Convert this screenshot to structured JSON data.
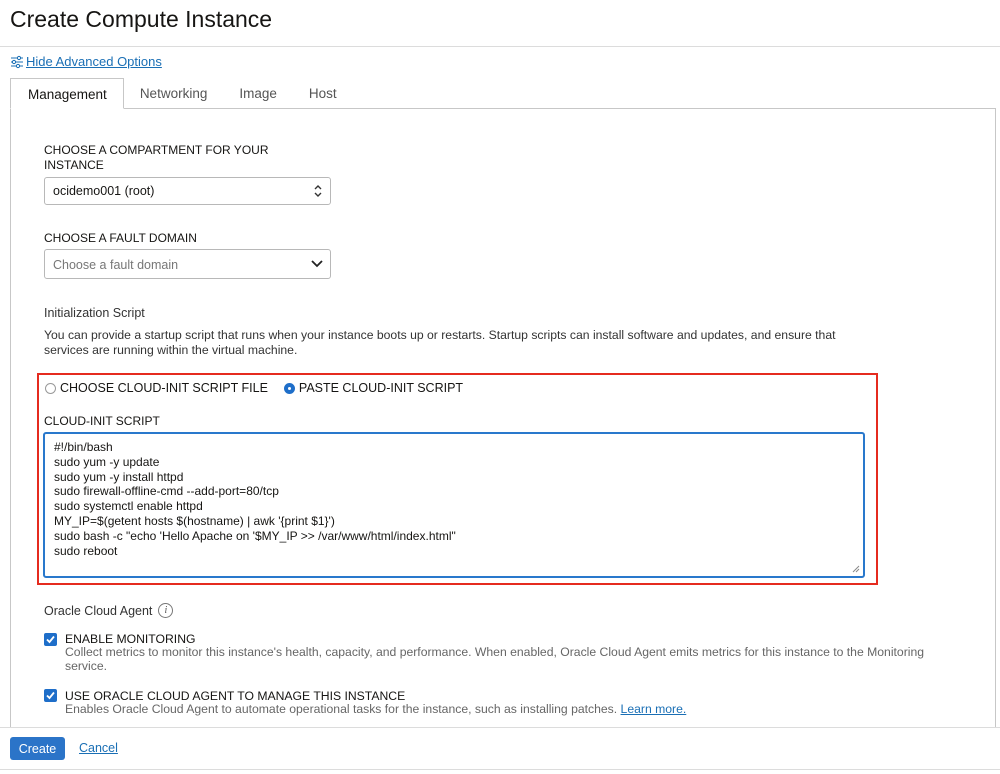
{
  "page": {
    "title": "Create Compute Instance"
  },
  "advanced": {
    "label": "Hide Advanced Options"
  },
  "tabs": [
    {
      "label": "Management",
      "active": true
    },
    {
      "label": "Networking",
      "active": false
    },
    {
      "label": "Image",
      "active": false
    },
    {
      "label": "Host",
      "active": false
    }
  ],
  "compartment": {
    "label_line1": "CHOOSE A COMPARTMENT FOR YOUR",
    "label_line2": "INSTANCE",
    "value": "ocidemo001 (root)"
  },
  "fault_domain": {
    "label": "CHOOSE A FAULT DOMAIN",
    "placeholder": "Choose a fault domain"
  },
  "init_script": {
    "title": "Initialization Script",
    "description": "You can provide a startup script that runs when your instance boots up or restarts. Startup scripts can install software and updates, and ensure that services are running within the virtual machine.",
    "options": [
      {
        "label": "CHOOSE CLOUD-INIT SCRIPT FILE",
        "selected": false
      },
      {
        "label": "PASTE CLOUD-INIT SCRIPT",
        "selected": true
      }
    ],
    "script_label": "CLOUD-INIT SCRIPT",
    "script_lines": [
      "#!/bin/bash",
      "sudo yum -y update",
      "sudo yum -y install httpd",
      "sudo firewall-offline-cmd --add-port=80/tcp",
      "sudo systemctl enable httpd",
      "MY_IP=$(getent hosts $(hostname) | awk '{print $1}')",
      "sudo bash -c \"echo 'Hello Apache on '$MY_IP >> /var/www/html/index.html\"",
      "sudo reboot"
    ]
  },
  "agent": {
    "title": "Oracle Cloud Agent",
    "monitoring": {
      "label": "ENABLE MONITORING",
      "checked": true,
      "description": "Collect metrics to monitor this instance's health, capacity, and performance. When enabled, Oracle Cloud Agent emits metrics for this instance to the Monitoring service."
    },
    "manage": {
      "label": "USE ORACLE CLOUD AGENT TO MANAGE THIS INSTANCE",
      "checked": true,
      "description": "Enables Oracle Cloud Agent to automate operational tasks for the instance, such as installing patches.",
      "link": "Learn more."
    }
  },
  "footer": {
    "create_label": "Create",
    "cancel_label": "Cancel"
  },
  "colors": {
    "accent": "#2b74c8",
    "highlight_box": "#e52b1f",
    "link": "#1a6fb5"
  },
  "icons": [
    "sliders-icon",
    "updown-chevron-icon",
    "chevron-down-icon",
    "resize-handle-icon",
    "info-icon",
    "checkmark-icon"
  ]
}
